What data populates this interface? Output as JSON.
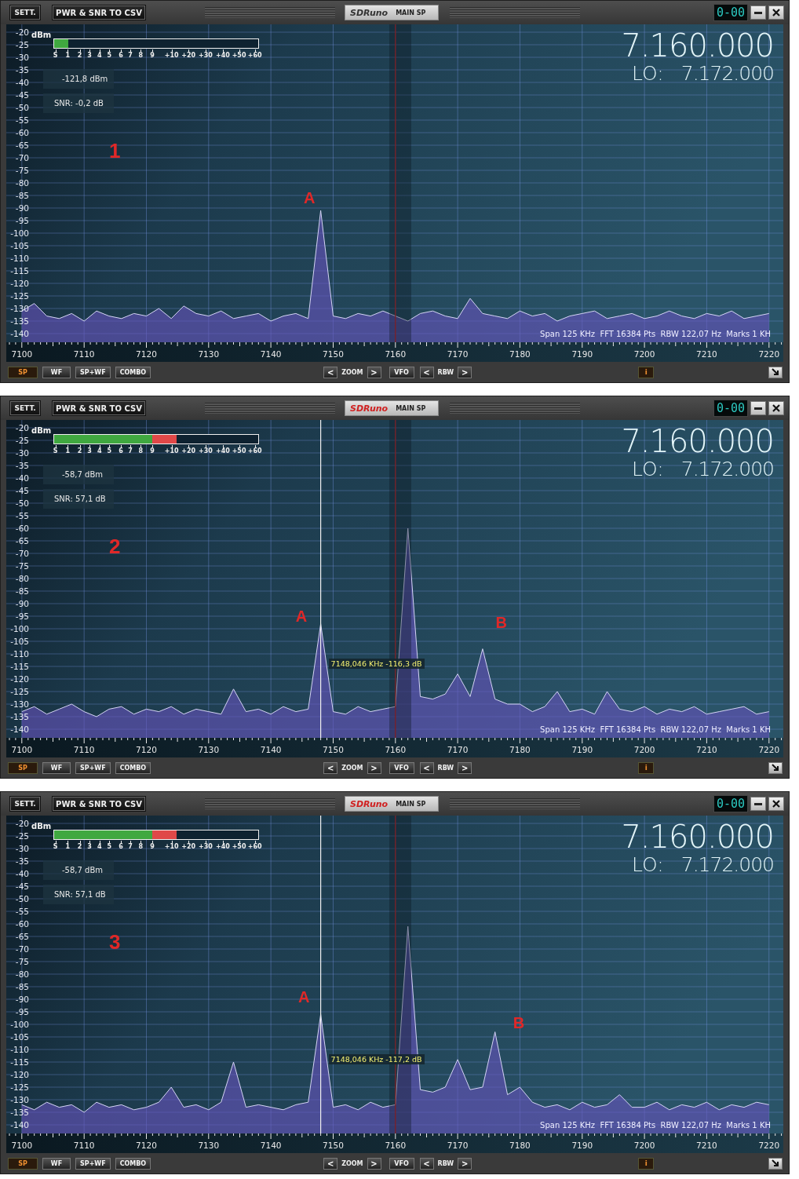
{
  "panels": [
    {
      "header": {
        "settings": "SETT.",
        "export": "PWR & SNR TO CSV",
        "tab": {
          "logo": "SDRuno",
          "label": "MAIN SP",
          "active": false
        },
        "clock": "0-00"
      },
      "meter": {
        "unit": "dBm",
        "level": 0.07,
        "scale": [
          "S",
          "1",
          "2",
          "3",
          "4",
          "5",
          "6",
          "7",
          "8",
          "9",
          "+10",
          "+20",
          "+30",
          "+40",
          "+50",
          "+60"
        ],
        "power": "-121,8 dBm",
        "snr": "SNR: -0,2 dB"
      },
      "frequency": "7.160.000",
      "lo_label": "LO:",
      "lo": "7.172.000",
      "info": "Span 125 KHz  FFT 16384 Pts  RBW 122,07 Hz  Marks 1 KH",
      "panel_number": "1",
      "chart_data": {
        "type": "area",
        "grid": true,
        "xlim": [
          7097.5,
          7222.3
        ],
        "ylim": [
          -140,
          -20
        ],
        "xticks": [
          7100,
          7110,
          7120,
          7130,
          7140,
          7150,
          7160,
          7170,
          7180,
          7190,
          7200,
          7210,
          7220
        ],
        "yticks": [
          -20,
          -25,
          -30,
          -35,
          -40,
          -45,
          -50,
          -55,
          -60,
          -65,
          -70,
          -75,
          -80,
          -85,
          -90,
          -95,
          -100,
          -105,
          -110,
          -115,
          -120,
          -125,
          -130,
          -135,
          -140
        ],
        "x": [
          7100,
          7102,
          7104,
          7106,
          7108,
          7110,
          7112,
          7114,
          7116,
          7118,
          7120,
          7122,
          7124,
          7126,
          7128,
          7130,
          7132,
          7134,
          7136,
          7138,
          7140,
          7142,
          7144,
          7146,
          7148,
          7150,
          7152,
          7154,
          7156,
          7158,
          7160,
          7162,
          7164,
          7166,
          7168,
          7170,
          7172,
          7174,
          7176,
          7178,
          7180,
          7182,
          7184,
          7186,
          7188,
          7190,
          7192,
          7194,
          7196,
          7198,
          7200,
          7202,
          7204,
          7206,
          7208,
          7210,
          7212,
          7214,
          7216,
          7218,
          7220
        ],
        "series": [
          {
            "color": "#d4d4f4",
            "values": [
              -131,
              -128,
              -133,
              -134,
              -132,
              -135,
              -131,
              -133,
              -134,
              -132,
              -133,
              -130,
              -134,
              -129,
              -132,
              -133,
              -131,
              -134,
              -133,
              -132,
              -135,
              -133,
              -132,
              -134,
              -91,
              -133,
              -134,
              -132,
              -133,
              -131,
              -133,
              -135,
              -132,
              -131,
              -133,
              -134,
              -126,
              -132,
              -133,
              -134,
              -131,
              -133,
              -132,
              -135,
              -133,
              -132,
              -131,
              -134,
              -133,
              -132,
              -134,
              -133,
              -131,
              -133,
              -134,
              -132,
              -133,
              -131,
              -134,
              -133,
              -132
            ]
          }
        ],
        "ref_lines": [
          {
            "axis": "x",
            "value": 7160,
            "color": "#c02020"
          }
        ],
        "annotations": [
          "A"
        ]
      },
      "footer": {
        "views": [
          {
            "label": "SP",
            "selected": true
          },
          {
            "label": "WF",
            "selected": false
          },
          {
            "label": "SP+WF",
            "selected": false
          },
          {
            "label": "COMBO",
            "selected": false
          }
        ],
        "zoom": {
          "prev": "<",
          "label": "ZOOM",
          "next": ">"
        },
        "vfo": "VFO",
        "rbw": {
          "prev": "<",
          "label": "RBW",
          "next": ">"
        },
        "info": "i"
      }
    },
    {
      "header": {
        "settings": "SETT.",
        "export": "PWR & SNR TO CSV",
        "tab": {
          "logo": "SDRuno",
          "label": "MAIN SP",
          "active": true
        },
        "clock": "0-00"
      },
      "meter": {
        "unit": "dBm",
        "level": 0.6,
        "scale": [
          "S",
          "1",
          "2",
          "3",
          "4",
          "5",
          "6",
          "7",
          "8",
          "9",
          "+10",
          "+20",
          "+30",
          "+40",
          "+50",
          "+60"
        ],
        "power": "-58,7 dBm",
        "snr": "SNR: 57,1 dB"
      },
      "frequency": "7.160.000",
      "lo_label": "LO:",
      "lo": "7.172.000",
      "info": "Span 125 KHz  FFT 16384 Pts  RBW 122,07 Hz  Marks 1 KH",
      "panel_number": "2",
      "marker_readout": "7148,046 KHz -116,3 dB",
      "chart_data": {
        "type": "area",
        "grid": true,
        "xlim": [
          7097.5,
          7222.3
        ],
        "ylim": [
          -140,
          -20
        ],
        "xticks": [
          7100,
          7110,
          7120,
          7130,
          7140,
          7150,
          7160,
          7170,
          7180,
          7190,
          7200,
          7210,
          7220
        ],
        "yticks": [
          -20,
          -25,
          -30,
          -35,
          -40,
          -45,
          -50,
          -55,
          -60,
          -65,
          -70,
          -75,
          -80,
          -85,
          -90,
          -95,
          -100,
          -105,
          -110,
          -115,
          -120,
          -125,
          -130,
          -135,
          -140
        ],
        "x": [
          7100,
          7102,
          7104,
          7106,
          7108,
          7110,
          7112,
          7114,
          7116,
          7118,
          7120,
          7122,
          7124,
          7126,
          7128,
          7130,
          7132,
          7134,
          7136,
          7138,
          7140,
          7142,
          7144,
          7146,
          7148,
          7150,
          7152,
          7154,
          7156,
          7158,
          7160,
          7162,
          7164,
          7166,
          7168,
          7170,
          7172,
          7174,
          7176,
          7178,
          7180,
          7182,
          7184,
          7186,
          7188,
          7190,
          7192,
          7194,
          7196,
          7198,
          7200,
          7202,
          7204,
          7206,
          7208,
          7210,
          7212,
          7214,
          7216,
          7218,
          7220
        ],
        "series": [
          {
            "color": "#d4d4f4",
            "values": [
              -133,
              -131,
              -134,
              -132,
              -130,
              -133,
              -135,
              -132,
              -131,
              -134,
              -132,
              -133,
              -131,
              -134,
              -132,
              -133,
              -134,
              -124,
              -133,
              -132,
              -134,
              -131,
              -133,
              -132,
              -98,
              -133,
              -134,
              -131,
              -133,
              -132,
              -131,
              -60,
              -127,
              -128,
              -126,
              -118,
              -127,
              -108,
              -128,
              -130,
              -130,
              -133,
              -131,
              -125,
              -133,
              -132,
              -134,
              -125,
              -132,
              -133,
              -131,
              -134,
              -132,
              -133,
              -131,
              -134,
              -133,
              -132,
              -131,
              -134,
              -133
            ]
          }
        ],
        "ref_lines": [
          {
            "axis": "x",
            "value": 7160,
            "color": "#c02020"
          },
          {
            "axis": "x",
            "value": 7148,
            "color": "#f0f0f0"
          }
        ],
        "annotations": [
          "A",
          "B"
        ]
      },
      "footer": {
        "views": [
          {
            "label": "SP",
            "selected": true
          },
          {
            "label": "WF",
            "selected": false
          },
          {
            "label": "SP+WF",
            "selected": false
          },
          {
            "label": "COMBO",
            "selected": false
          }
        ],
        "zoom": {
          "prev": "<",
          "label": "ZOOM",
          "next": ">"
        },
        "vfo": "VFO",
        "rbw": {
          "prev": "<",
          "label": "RBW",
          "next": ">"
        },
        "info": "i"
      }
    },
    {
      "header": {
        "settings": "SETT.",
        "export": "PWR & SNR TO CSV",
        "tab": {
          "logo": "SDRuno",
          "label": "MAIN SP",
          "active": true
        },
        "clock": "0-00"
      },
      "meter": {
        "unit": "dBm",
        "level": 0.6,
        "scale": [
          "S",
          "1",
          "2",
          "3",
          "4",
          "5",
          "6",
          "7",
          "8",
          "9",
          "+10",
          "+20",
          "+30",
          "+40",
          "+50",
          "+60"
        ],
        "power": "-58,7 dBm",
        "snr": "SNR: 57,1 dB"
      },
      "frequency": "7.160.000",
      "lo_label": "LO:",
      "lo": "7.172.000",
      "info": "Span 125 KHz  FFT 16384 Pts  RBW 122,07 Hz  Marks 1 KH",
      "panel_number": "3",
      "marker_readout": "7148,046 KHz -117,2 dB",
      "chart_data": {
        "type": "area",
        "grid": true,
        "xlim": [
          7097.5,
          7222.3
        ],
        "ylim": [
          -140,
          -20
        ],
        "xticks": [
          7100,
          7110,
          7120,
          7130,
          7140,
          7150,
          7160,
          7170,
          7180,
          7190,
          7200,
          7210,
          7220
        ],
        "yticks": [
          -20,
          -25,
          -30,
          -35,
          -40,
          -45,
          -50,
          -55,
          -60,
          -65,
          -70,
          -75,
          -80,
          -85,
          -90,
          -95,
          -100,
          -105,
          -110,
          -115,
          -120,
          -125,
          -130,
          -135,
          -140
        ],
        "x": [
          7100,
          7102,
          7104,
          7106,
          7108,
          7110,
          7112,
          7114,
          7116,
          7118,
          7120,
          7122,
          7124,
          7126,
          7128,
          7130,
          7132,
          7134,
          7136,
          7138,
          7140,
          7142,
          7144,
          7146,
          7148,
          7150,
          7152,
          7154,
          7156,
          7158,
          7160,
          7162,
          7164,
          7166,
          7168,
          7170,
          7172,
          7174,
          7176,
          7178,
          7180,
          7182,
          7184,
          7186,
          7188,
          7190,
          7192,
          7194,
          7196,
          7198,
          7200,
          7202,
          7204,
          7206,
          7208,
          7210,
          7212,
          7214,
          7216,
          7218,
          7220
        ],
        "series": [
          {
            "color": "#d4d4f4",
            "values": [
              -132,
              -134,
              -131,
              -133,
              -132,
              -135,
              -131,
              -133,
              -132,
              -134,
              -133,
              -131,
              -125,
              -133,
              -132,
              -134,
              -131,
              -115,
              -133,
              -132,
              -133,
              -134,
              -132,
              -131,
              -96,
              -133,
              -132,
              -134,
              -131,
              -133,
              -132,
              -61,
              -126,
              -127,
              -125,
              -114,
              -126,
              -125,
              -103,
              -128,
              -125,
              -131,
              -133,
              -132,
              -134,
              -131,
              -133,
              -132,
              -128,
              -133,
              -133,
              -131,
              -134,
              -132,
              -133,
              -131,
              -134,
              -132,
              -133,
              -131,
              -132
            ]
          }
        ],
        "ref_lines": [
          {
            "axis": "x",
            "value": 7160,
            "color": "#c02020"
          },
          {
            "axis": "x",
            "value": 7148,
            "color": "#f0f0f0"
          }
        ],
        "annotations": [
          "A",
          "B"
        ]
      },
      "footer": {
        "views": [
          {
            "label": "SP",
            "selected": true
          },
          {
            "label": "WF",
            "selected": false
          },
          {
            "label": "SP+WF",
            "selected": false
          },
          {
            "label": "COMBO",
            "selected": false
          }
        ],
        "zoom": {
          "prev": "<",
          "label": "ZOOM",
          "next": ">"
        },
        "vfo": "VFO",
        "rbw": {
          "prev": "<",
          "label": "RBW",
          "next": ">"
        },
        "info": "i"
      }
    }
  ]
}
